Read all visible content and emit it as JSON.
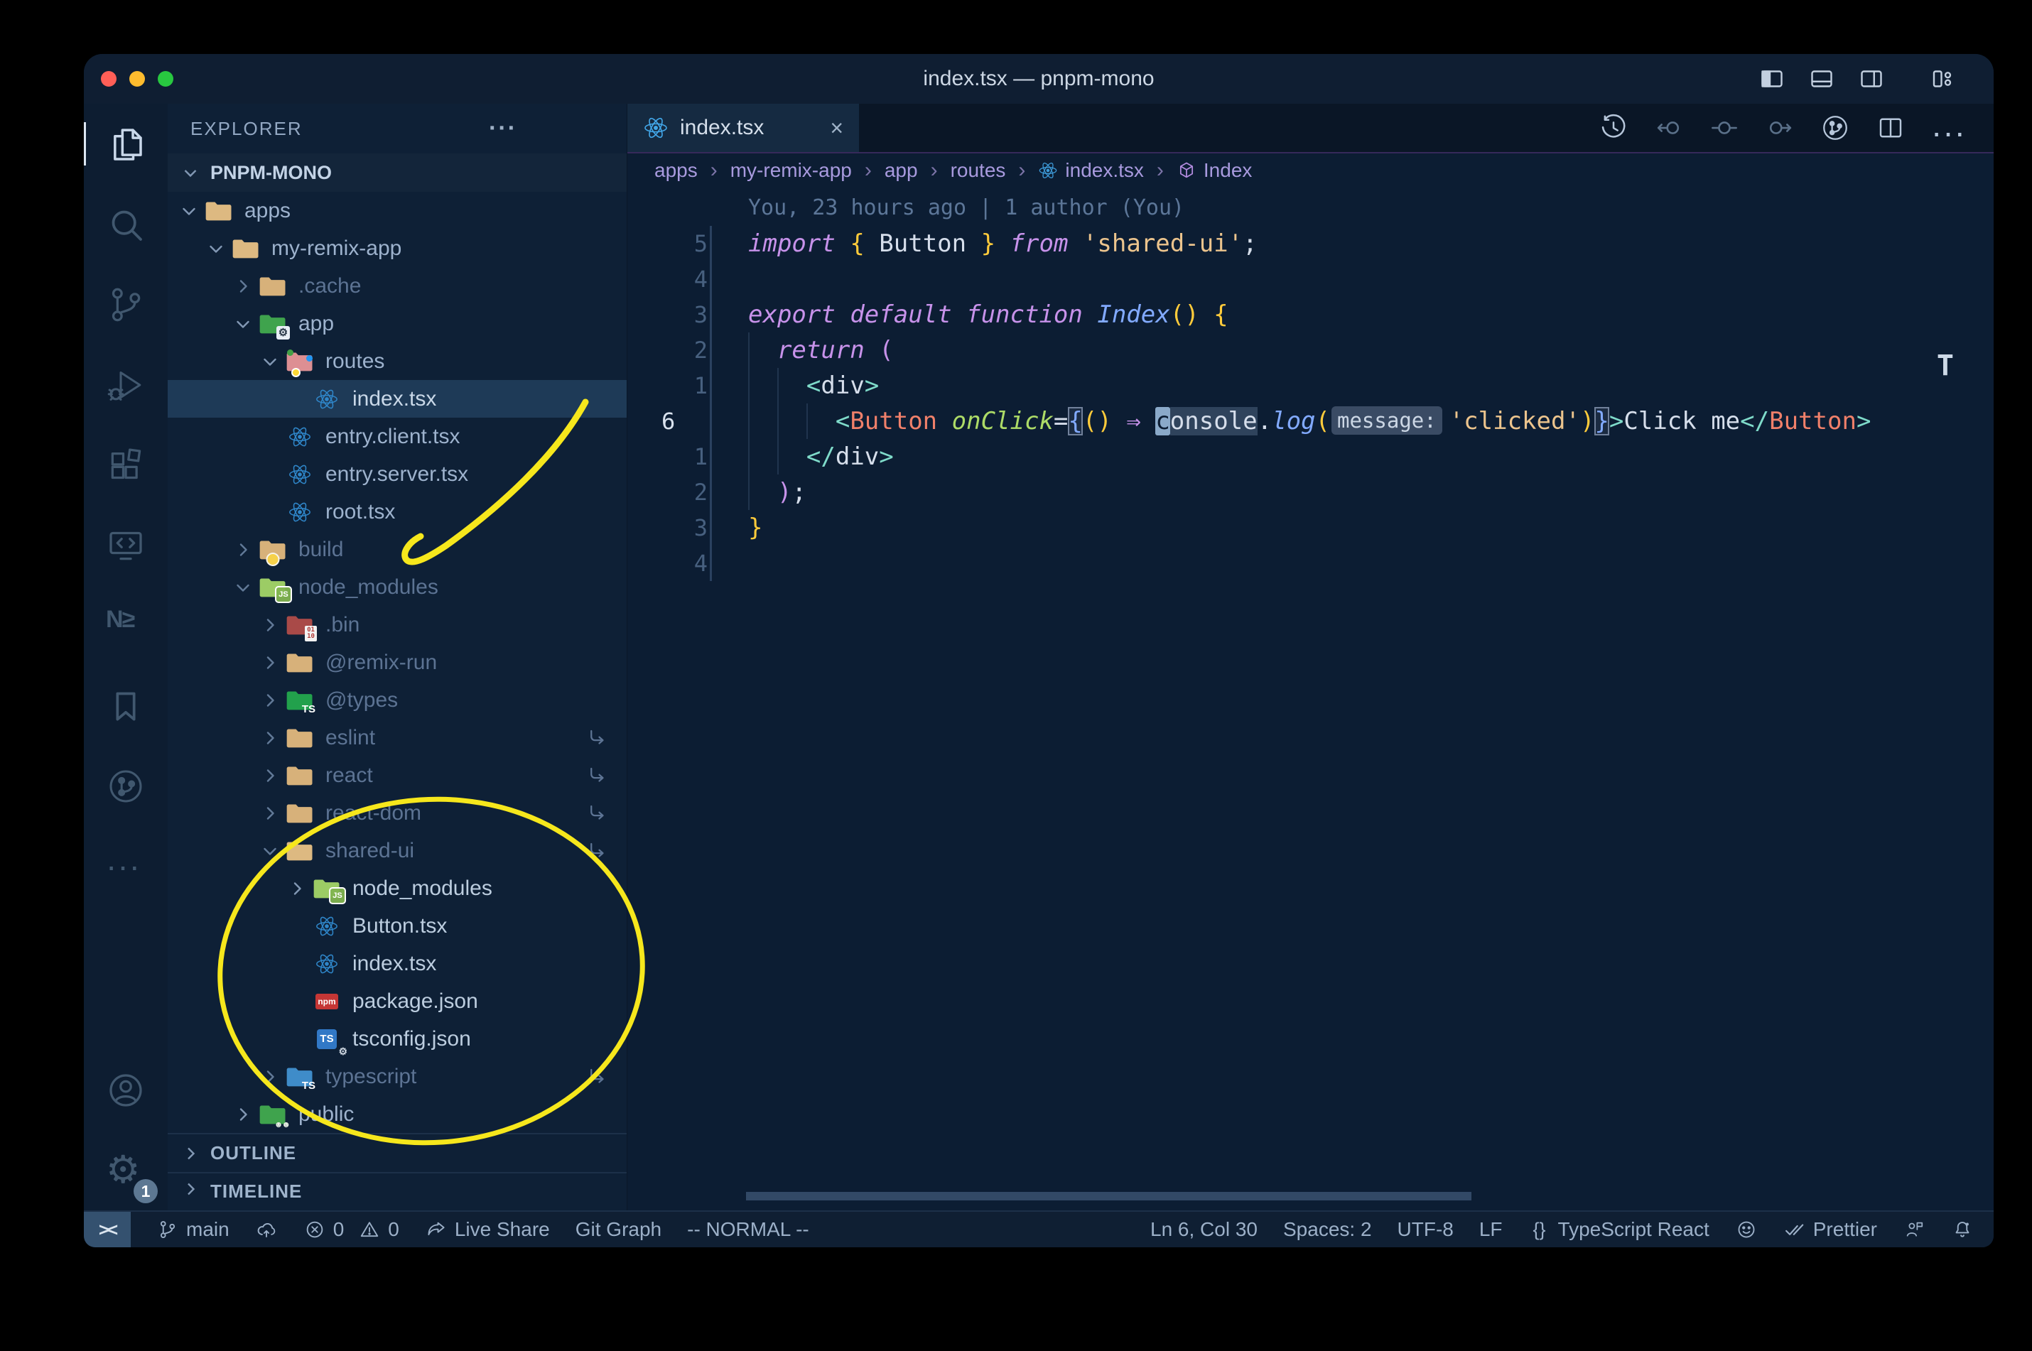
{
  "window": {
    "title": "index.tsx — pnpm-mono"
  },
  "title_bar": {
    "icons": [
      {
        "name": "toggle-primary-sidebar-icon",
        "icon": "layout-left"
      },
      {
        "name": "toggle-panel-icon",
        "icon": "layout-panel"
      },
      {
        "name": "toggle-secondary-sidebar-icon",
        "icon": "layout-right"
      },
      {
        "name": "separator",
        "icon": "sep"
      },
      {
        "name": "customize-layout-icon",
        "icon": "layout-custom"
      }
    ]
  },
  "activity_bar": {
    "top": [
      {
        "name": "explorer",
        "icon": "files",
        "active": true
      },
      {
        "name": "search",
        "icon": "search"
      },
      {
        "name": "source-control",
        "icon": "source-control"
      },
      {
        "name": "run-and-debug",
        "icon": "debug"
      },
      {
        "name": "extensions",
        "icon": "extensions"
      },
      {
        "name": "remote-explorer",
        "icon": "remote"
      },
      {
        "name": "nx-console",
        "icon": "nx"
      },
      {
        "name": "bookmarks",
        "icon": "bookmark"
      },
      {
        "name": "gitlens",
        "icon": "gitlens"
      },
      {
        "name": "more-views",
        "icon": "more"
      }
    ],
    "bottom": [
      {
        "name": "accounts",
        "icon": "account"
      },
      {
        "name": "settings",
        "icon": "gear",
        "badge": "1"
      }
    ]
  },
  "explorer": {
    "header": "EXPLORER",
    "more_label": "···",
    "section": "PNPM-MONO",
    "outline_label": "OUTLINE",
    "timeline_label": "TIMELINE",
    "tree": [
      {
        "label": "apps",
        "level": 1,
        "icon": "folder-open",
        "chevron": "open"
      },
      {
        "label": "my-remix-app",
        "level": 2,
        "icon": "folder-open",
        "chevron": "open"
      },
      {
        "label": ".cache",
        "level": 3,
        "icon": "folder",
        "chevron": "closed",
        "dim": true
      },
      {
        "label": "app",
        "level": 3,
        "icon": "folder-app",
        "chevron": "open"
      },
      {
        "label": "routes",
        "level": 4,
        "icon": "folder-routes",
        "chevron": "open"
      },
      {
        "label": "index.tsx",
        "level": 5,
        "icon": "react",
        "selected": true
      },
      {
        "label": "entry.client.tsx",
        "level": 4,
        "icon": "react"
      },
      {
        "label": "entry.server.tsx",
        "level": 4,
        "icon": "react"
      },
      {
        "label": "root.tsx",
        "level": 4,
        "icon": "react"
      },
      {
        "label": "build",
        "level": 3,
        "icon": "folder-build",
        "chevron": "closed",
        "dim": true
      },
      {
        "label": "node_modules",
        "level": 3,
        "icon": "folder-node",
        "chevron": "open",
        "dim": true
      },
      {
        "label": ".bin",
        "level": 4,
        "icon": "folder-bin",
        "chevron": "closed",
        "dim": true
      },
      {
        "label": "@remix-run",
        "level": 4,
        "icon": "folder",
        "chevron": "closed",
        "dim": true
      },
      {
        "label": "@types",
        "level": 4,
        "icon": "folder-types",
        "chevron": "closed",
        "dim": true
      },
      {
        "label": "eslint",
        "level": 4,
        "icon": "folder",
        "chevron": "closed",
        "dim": true,
        "symlink": true
      },
      {
        "label": "react",
        "level": 4,
        "icon": "folder",
        "chevron": "closed",
        "dim": true,
        "symlink": true
      },
      {
        "label": "react-dom",
        "level": 4,
        "icon": "folder",
        "chevron": "closed",
        "dim": true,
        "symlink": true
      },
      {
        "label": "shared-ui",
        "level": 4,
        "icon": "folder-open",
        "chevron": "open",
        "dim": true,
        "symlink": true
      },
      {
        "label": "node_modules",
        "level": 5,
        "icon": "folder-node",
        "chevron": "closed",
        "bright": true
      },
      {
        "label": "Button.tsx",
        "level": 5,
        "icon": "react",
        "bright": true
      },
      {
        "label": "index.tsx",
        "level": 5,
        "icon": "react",
        "bright": true
      },
      {
        "label": "package.json",
        "level": 5,
        "icon": "npm",
        "bright": true
      },
      {
        "label": "tsconfig.json",
        "level": 5,
        "icon": "tsconfig",
        "bright": true
      },
      {
        "label": "typescript",
        "level": 4,
        "icon": "folder-ts",
        "chevron": "closed",
        "dim": true,
        "symlink": true
      },
      {
        "label": "public",
        "level": 3,
        "icon": "folder-public",
        "chevron": "closed"
      }
    ]
  },
  "editor": {
    "tab": {
      "label": "index.tsx",
      "icon": "react",
      "close": "×"
    },
    "toolbar": [
      {
        "name": "timeline-history-icon",
        "icon": "history"
      },
      {
        "name": "gitlens-previous-change-icon",
        "icon": "change-prev",
        "dim": true
      },
      {
        "name": "gitlens-changes-icon",
        "icon": "change-mid",
        "dim": true
      },
      {
        "name": "gitlens-next-change-icon",
        "icon": "change-next",
        "dim": true
      },
      {
        "name": "gitlens-graph-icon",
        "icon": "gitlens"
      },
      {
        "name": "split-editor-icon",
        "icon": "split"
      },
      {
        "name": "more-actions-icon",
        "icon": "more"
      }
    ],
    "breadcrumbs": [
      {
        "label": "apps"
      },
      {
        "label": "my-remix-app"
      },
      {
        "label": "app"
      },
      {
        "label": "routes"
      },
      {
        "label": "index.tsx",
        "icon": "react-sm"
      },
      {
        "label": "Index",
        "icon": "cube"
      }
    ],
    "blame": "You, 23 hours ago | 1 author (You)",
    "overflow_artifact": "T",
    "code_lines": [
      {
        "num": "5",
        "tokens": [
          [
            "import",
            "kw"
          ],
          [
            " ",
            "pl"
          ],
          [
            "{",
            "brace"
          ],
          [
            " ",
            "pl"
          ],
          [
            "Button",
            "var"
          ],
          [
            " ",
            "pl"
          ],
          [
            "}",
            "brace"
          ],
          [
            " ",
            "pl"
          ],
          [
            "from",
            "kw"
          ],
          [
            " ",
            "pl"
          ],
          [
            "'shared-ui'",
            "str"
          ],
          [
            ";",
            "punc"
          ]
        ]
      },
      {
        "num": "4",
        "tokens": []
      },
      {
        "num": "3",
        "tokens": [
          [
            "export",
            "kw"
          ],
          [
            " ",
            "pl"
          ],
          [
            "default",
            "kw"
          ],
          [
            " ",
            "pl"
          ],
          [
            "function",
            "kw"
          ],
          [
            " ",
            "pl"
          ],
          [
            "Index",
            "fn"
          ],
          [
            "(",
            "brace"
          ],
          [
            ")",
            "brace"
          ],
          [
            " ",
            "pl"
          ],
          [
            "{",
            "brace"
          ]
        ]
      },
      {
        "num": "2",
        "tokens": [
          [
            "  ",
            "pl"
          ],
          [
            "return",
            "kw"
          ],
          [
            " ",
            "pl"
          ],
          [
            "(",
            "ppink"
          ]
        ]
      },
      {
        "num": "1",
        "tokens": [
          [
            "    ",
            "pl"
          ],
          [
            "<",
            "tag"
          ],
          [
            "div",
            "var"
          ],
          [
            ">",
            "tag"
          ]
        ]
      },
      {
        "num": "6",
        "current": true,
        "tokens": [
          [
            "      ",
            "pl"
          ],
          [
            "<",
            "tag"
          ],
          [
            "Button",
            "comp"
          ],
          [
            " ",
            "pl"
          ],
          [
            "onClick",
            "attr"
          ],
          [
            "=",
            "punc"
          ],
          [
            "{",
            "bm"
          ],
          [
            "(",
            "brace"
          ],
          [
            ")",
            "brace"
          ],
          [
            " ",
            "pl"
          ],
          [
            "⇒",
            "arrow"
          ],
          [
            " ",
            "pl"
          ],
          [
            "c",
            "cursor"
          ],
          [
            "onsole",
            "whl"
          ],
          [
            ".",
            "punc"
          ],
          [
            "log",
            "fn"
          ],
          [
            "(",
            "brace"
          ],
          [
            "message:",
            "inlay"
          ],
          [
            "'clicked'",
            "str"
          ],
          [
            ")",
            "brace"
          ],
          [
            "}",
            "bm"
          ],
          [
            ">",
            "tag"
          ],
          [
            "Click me",
            "var"
          ],
          [
            "</",
            "tag"
          ],
          [
            "Button",
            "comp"
          ],
          [
            ">",
            "tag"
          ]
        ]
      },
      {
        "num": "1",
        "tokens": [
          [
            "    ",
            "pl"
          ],
          [
            "</",
            "tag"
          ],
          [
            "div",
            "var"
          ],
          [
            ">",
            "tag"
          ]
        ]
      },
      {
        "num": "2",
        "tokens": [
          [
            "  ",
            "pl"
          ],
          [
            ")",
            "ppink"
          ],
          [
            ";",
            "punc"
          ]
        ]
      },
      {
        "num": "3",
        "tokens": [
          [
            "}",
            "brace"
          ]
        ]
      },
      {
        "num": "4",
        "tokens": []
      }
    ]
  },
  "status_bar": {
    "left": [
      {
        "name": "remote-indicator",
        "type": "remote",
        "glyph": "><"
      },
      {
        "name": "git-branch",
        "icon": "branch",
        "label": "main"
      },
      {
        "name": "sync-changes",
        "icon": "cloud-up",
        "label": ""
      },
      {
        "name": "problems",
        "type": "problems",
        "errors": "0",
        "warnings": "0"
      },
      {
        "name": "live-share",
        "icon": "liveshare",
        "label": "Live Share"
      },
      {
        "name": "git-graph",
        "label": "Git Graph"
      },
      {
        "name": "vim-mode",
        "label": "-- NORMAL --"
      }
    ],
    "right": [
      {
        "name": "cursor-position",
        "label": "Ln 6, Col 30"
      },
      {
        "name": "indentation",
        "label": "Spaces: 2"
      },
      {
        "name": "encoding",
        "label": "UTF-8"
      },
      {
        "name": "eol",
        "label": "LF"
      },
      {
        "name": "language-mode",
        "icon": "braces",
        "label": "TypeScript React"
      },
      {
        "name": "copilot",
        "icon": "smiley",
        "label": ""
      },
      {
        "name": "formatter-prettier",
        "icon": "checkcheck",
        "label": "Prettier"
      },
      {
        "name": "feedback",
        "icon": "person-flag",
        "label": ""
      },
      {
        "name": "notifications",
        "icon": "bell",
        "label": ""
      }
    ]
  },
  "annotations": {
    "color": "#f6e71c",
    "shapes": [
      "arrow-to-node-modules",
      "ellipse-around-shared-ui"
    ]
  }
}
